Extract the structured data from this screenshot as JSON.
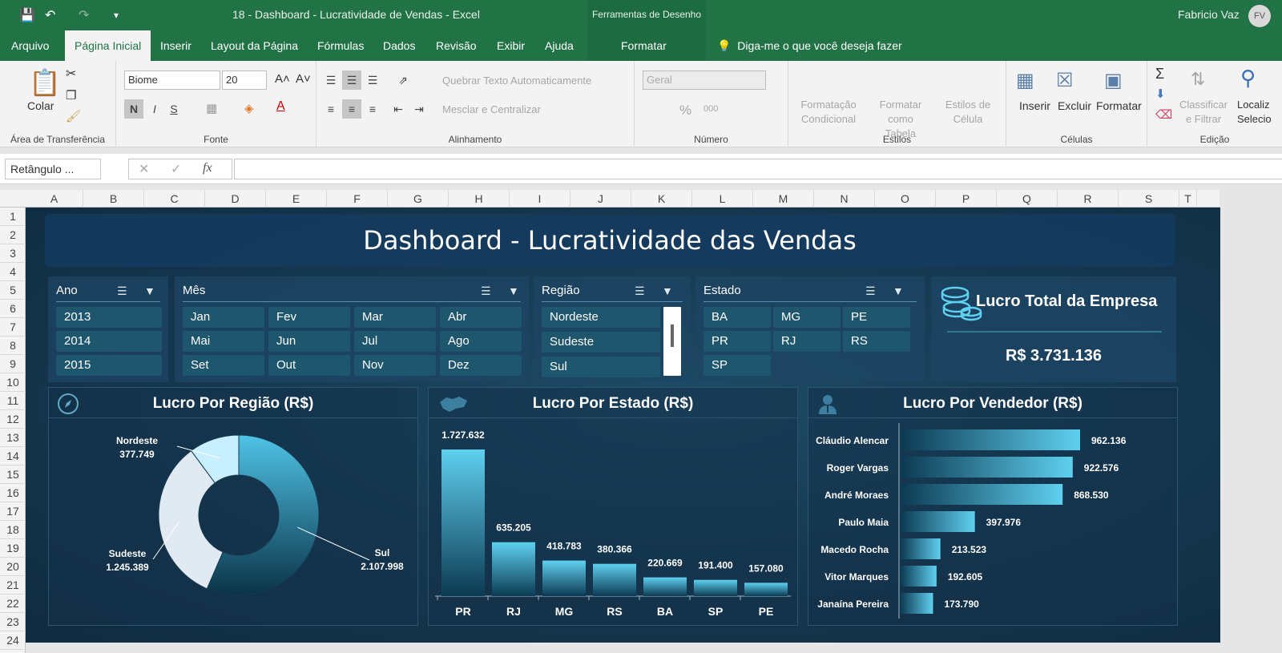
{
  "titlebar": {
    "doc_title": "18 - Dashboard - Lucratividade de Vendas  -  Excel",
    "context_tools": "Ferramentas de Desenho",
    "user": "Fabricio Vaz",
    "user_initials": "FV"
  },
  "tabs": [
    "Arquivo",
    "Página Inicial",
    "Inserir",
    "Layout da Página",
    "Fórmulas",
    "Dados",
    "Revisão",
    "Exibir",
    "Ajuda",
    "Formatar"
  ],
  "tell_me": "Diga-me o que você deseja fazer",
  "ribbon": {
    "clipboard": {
      "paste": "Colar",
      "label": "Área de Transferência"
    },
    "font": {
      "name": "Biome",
      "size": "20",
      "label": "Fonte",
      "bold": "N",
      "italic": "I",
      "underline": "S"
    },
    "alignment": {
      "wrap": "Quebrar Texto Automaticamente",
      "merge": "Mesclar e Centralizar",
      "label": "Alinhamento"
    },
    "number": {
      "format": "Geral",
      "label": "Número"
    },
    "styles": {
      "conditional": [
        "Formatação",
        "Condicional"
      ],
      "table": [
        "Formatar como",
        "Tabela"
      ],
      "cell": [
        "Estilos de",
        "Célula"
      ],
      "label": "Estilos"
    },
    "cells": {
      "insert": "Inserir",
      "delete": "Excluir",
      "format": "Formatar",
      "label": "Células"
    },
    "editing": {
      "sort": [
        "Classificar",
        "e Filtrar"
      ],
      "find": [
        "Localiz",
        "Selecio"
      ],
      "label": "Edição"
    }
  },
  "formula_bar": {
    "name_box": "Retângulo ...",
    "fx": "fx"
  },
  "columns": [
    "A",
    "B",
    "C",
    "D",
    "E",
    "F",
    "G",
    "H",
    "I",
    "J",
    "K",
    "L",
    "M",
    "N",
    "O",
    "P",
    "Q",
    "R",
    "S",
    "T"
  ],
  "rows": [
    "1",
    "2",
    "3",
    "4",
    "5",
    "6",
    "7",
    "8",
    "9",
    "10",
    "11",
    "12",
    "13",
    "14",
    "15",
    "16",
    "17",
    "18",
    "19",
    "20",
    "21",
    "22",
    "23",
    "24"
  ],
  "dashboard": {
    "title": "Dashboard - Lucratividade das Vendas",
    "slicers": {
      "ano": {
        "title": "Ano",
        "items": [
          "2013",
          "2014",
          "2015"
        ]
      },
      "mes": {
        "title": "Mês",
        "items": [
          "Jan",
          "Fev",
          "Mar",
          "Abr",
          "Mai",
          "Jun",
          "Jul",
          "Ago",
          "Set",
          "Out",
          "Nov",
          "Dez"
        ]
      },
      "regiao": {
        "title": "Região",
        "items": [
          "Nordeste",
          "Sudeste",
          "Sul"
        ]
      },
      "estado": {
        "title": "Estado",
        "items": [
          "BA",
          "MG",
          "PE",
          "PR",
          "RJ",
          "RS",
          "SP"
        ]
      }
    },
    "kpi": {
      "title": "Lucro Total da Empresa",
      "value": "R$ 3.731.136"
    }
  },
  "colors": {
    "excel_green": "#217346",
    "bar_light": "#5fd0f0",
    "bar_dark": "#0c3a52"
  },
  "chart_data": [
    {
      "type": "pie",
      "title": "Lucro Por Região (R$)",
      "categories": [
        "Nordeste",
        "Sudeste",
        "Sul"
      ],
      "values": [
        377749,
        1245389,
        2107998
      ],
      "labels": [
        "377.749",
        "1.245.389",
        "2.107.998"
      ]
    },
    {
      "type": "bar",
      "title": "Lucro Por Estado (R$)",
      "categories": [
        "PR",
        "RJ",
        "MG",
        "RS",
        "BA",
        "SP",
        "PE"
      ],
      "values": [
        1727632,
        635205,
        418783,
        380366,
        220669,
        191400,
        157080
      ],
      "labels": [
        "1.727.632",
        "635.205",
        "418.783",
        "380.366",
        "220.669",
        "191.400",
        "157.080"
      ]
    },
    {
      "type": "bar",
      "orientation": "horizontal",
      "title": "Lucro Por Vendedor (R$)",
      "categories": [
        "Cláudio Alencar",
        "Roger Vargas",
        "André Moraes",
        "Paulo Maia",
        "Macedo Rocha",
        "Vitor Marques",
        "Janaína Pereira"
      ],
      "values": [
        962136,
        922576,
        868530,
        397976,
        213523,
        192605,
        173790
      ],
      "labels": [
        "962.136",
        "922.576",
        "868.530",
        "397.976",
        "213.523",
        "192.605",
        "173.790"
      ]
    }
  ]
}
